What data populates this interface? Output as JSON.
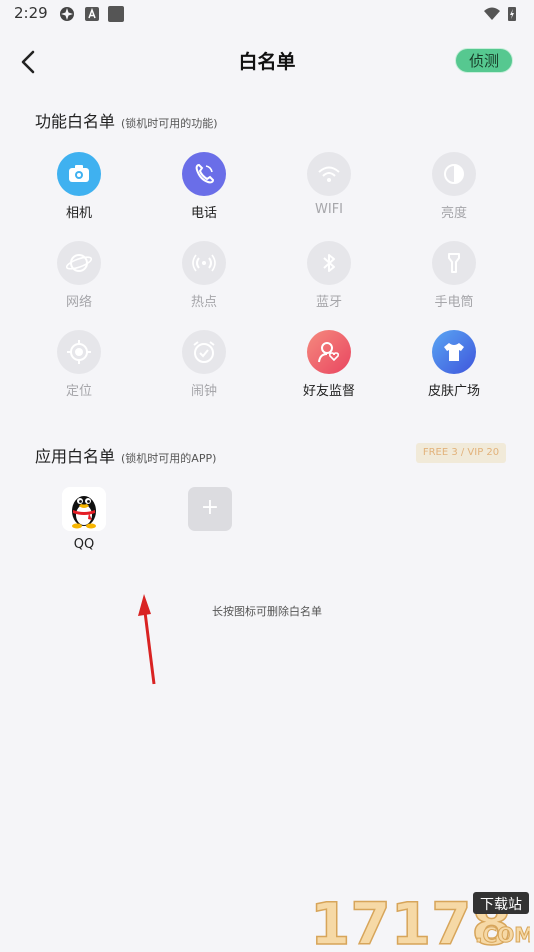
{
  "status": {
    "time": "2:29"
  },
  "header": {
    "title": "白名单",
    "detect_label": "侦测"
  },
  "func_section": {
    "title": "功能白名单",
    "subtitle": "(锁机时可用的功能)",
    "items": [
      {
        "label": "相机",
        "icon": "camera-icon",
        "enabled": true
      },
      {
        "label": "电话",
        "icon": "phone-icon",
        "enabled": true
      },
      {
        "label": "WIFI",
        "icon": "wifi-icon",
        "enabled": false
      },
      {
        "label": "亮度",
        "icon": "brightness-icon",
        "enabled": false
      },
      {
        "label": "网络",
        "icon": "network-icon",
        "enabled": false
      },
      {
        "label": "热点",
        "icon": "hotspot-icon",
        "enabled": false
      },
      {
        "label": "蓝牙",
        "icon": "bluetooth-icon",
        "enabled": false
      },
      {
        "label": "手电筒",
        "icon": "flashlight-icon",
        "enabled": false
      },
      {
        "label": "定位",
        "icon": "location-icon",
        "enabled": false
      },
      {
        "label": "闹钟",
        "icon": "alarm-icon",
        "enabled": false
      },
      {
        "label": "好友监督",
        "icon": "friend-supervise-icon",
        "enabled": true
      },
      {
        "label": "皮肤广场",
        "icon": "skin-shirt-icon",
        "enabled": true
      }
    ]
  },
  "app_section": {
    "title": "应用白名单",
    "subtitle": "(锁机时可用的APP)",
    "badge": "FREE 3 / VIP 20",
    "apps": [
      {
        "label": "QQ",
        "icon": "qq-penguin-icon"
      }
    ],
    "add_label": "+",
    "hint": "长按图标可删除白名单"
  },
  "colors": {
    "accent_green": "#56c890",
    "camera": "#3fb1f0",
    "phone": "#6a6ee8",
    "friend": "#ee5d6b",
    "skin": "#4a7be6"
  },
  "watermark": {
    "text": "17178",
    "tag": "下载站",
    "domain": ".COM"
  }
}
